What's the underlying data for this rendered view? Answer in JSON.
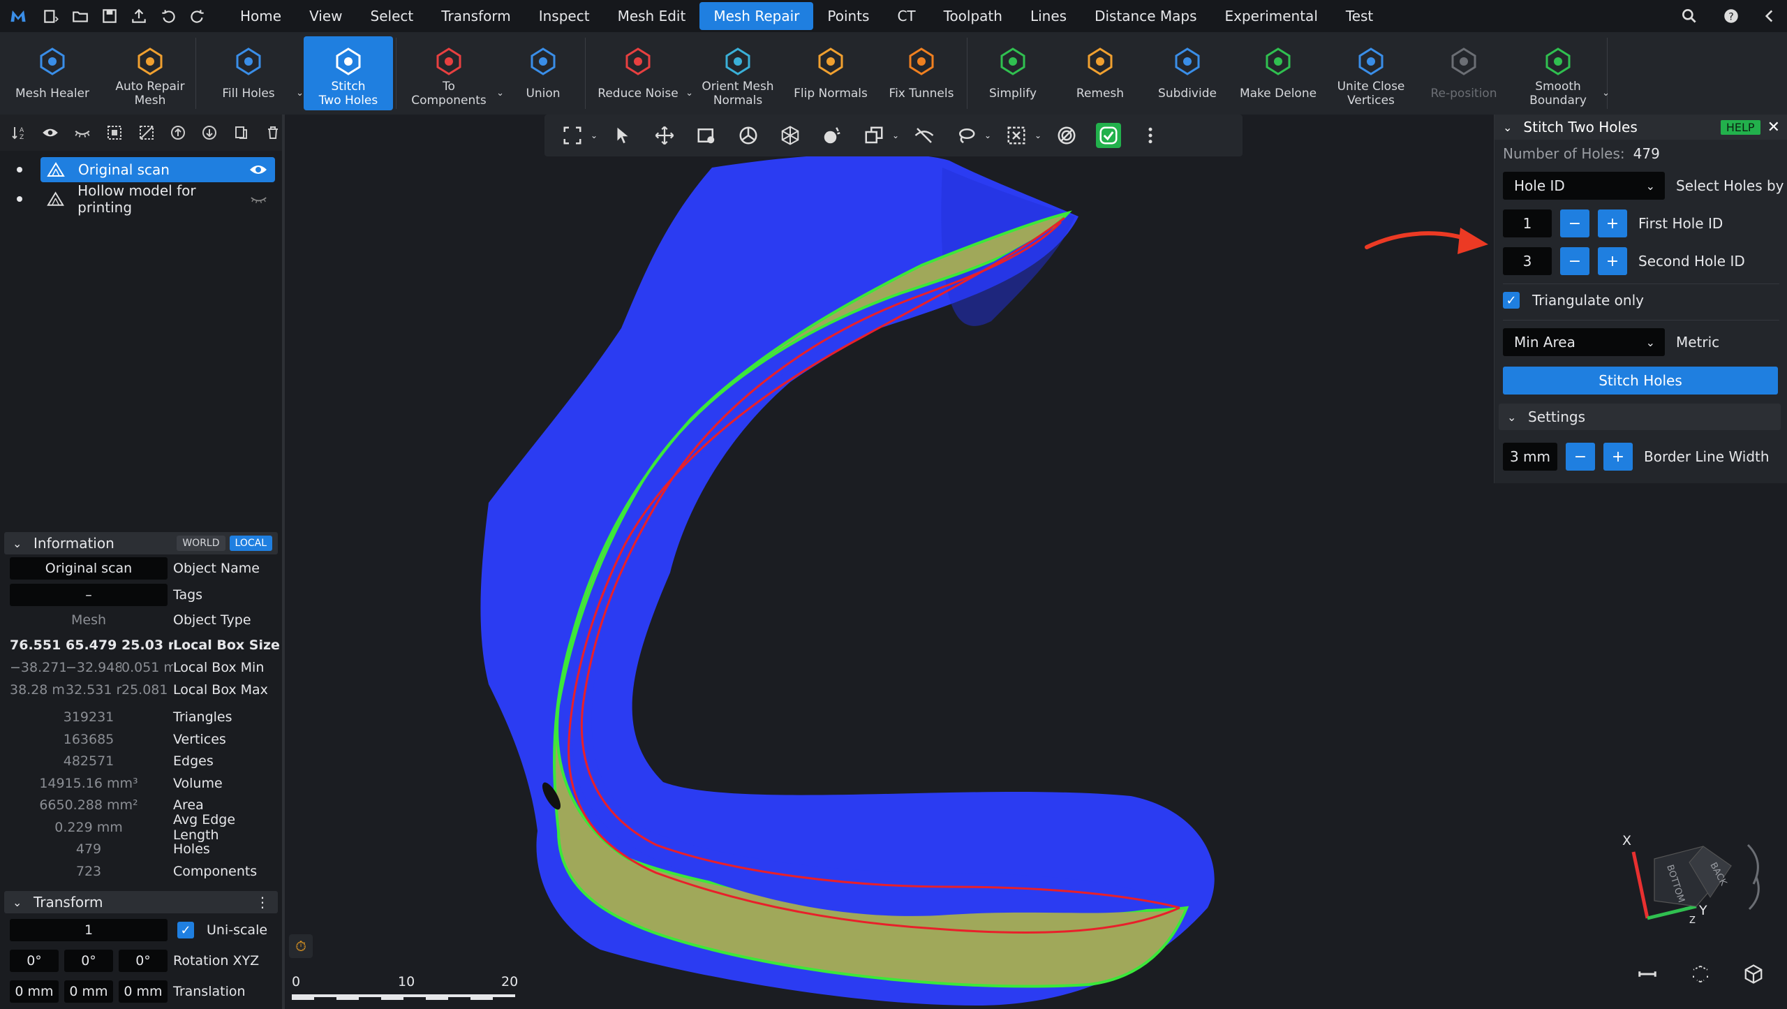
{
  "menubar": {
    "tabs": [
      "Home",
      "View",
      "Select",
      "Transform",
      "Inspect",
      "Mesh Edit",
      "Mesh Repair",
      "Points",
      "CT",
      "Toolpath",
      "Lines",
      "Distance Maps",
      "Experimental",
      "Test"
    ],
    "active": "Mesh Repair"
  },
  "ribbon": {
    "tools": [
      {
        "label": "Mesh Healer",
        "icon": "mesh-healer-icon",
        "color": "#3a8ee8"
      },
      {
        "label": "Auto Repair\nMesh",
        "icon": "auto-repair-icon",
        "color": "#f0a030"
      },
      {
        "label": "Fill Holes",
        "icon": "fill-holes-icon",
        "color": "#3a8ee8",
        "dropdown": true
      },
      {
        "label": "Stitch\nTwo Holes",
        "icon": "stitch-holes-icon",
        "color": "#ffffff",
        "active": true
      },
      {
        "label": "To\nComponents",
        "icon": "to-components-icon",
        "color": "#e84040",
        "dropdown": true
      },
      {
        "label": "Union",
        "icon": "union-icon",
        "color": "#3a8ee8"
      },
      {
        "label": "Reduce Noise",
        "icon": "reduce-noise-icon",
        "color": "#e84040",
        "dropdown": true
      },
      {
        "label": "Orient Mesh\nNormals",
        "icon": "orient-normals-icon",
        "color": "#3ab0d8"
      },
      {
        "label": "Flip Normals",
        "icon": "flip-normals-icon",
        "color": "#f0a030"
      },
      {
        "label": "Fix Tunnels",
        "icon": "fix-tunnels-icon",
        "color": "#f08020"
      },
      {
        "label": "Simplify",
        "icon": "simplify-icon",
        "color": "#30c050"
      },
      {
        "label": "Remesh",
        "icon": "remesh-icon",
        "color": "#f0a030"
      },
      {
        "label": "Subdivide",
        "icon": "subdivide-icon",
        "color": "#3a8ee8"
      },
      {
        "label": "Make Delone",
        "icon": "make-delone-icon",
        "color": "#30c050"
      },
      {
        "label": "Unite Close\nVertices",
        "icon": "unite-vertices-icon",
        "color": "#3a8ee8"
      },
      {
        "label": "Re-position",
        "icon": "reposition-icon",
        "color": "#6b6e74",
        "disabled": true
      },
      {
        "label": "Smooth\nBoundary",
        "icon": "smooth-boundary-icon",
        "color": "#30c050",
        "dropdown": true
      }
    ]
  },
  "scene": {
    "objects": [
      {
        "name": "Original scan",
        "selected": true
      },
      {
        "name": "Hollow model for printing",
        "selected": false
      }
    ]
  },
  "info": {
    "title": "Information",
    "world": "WORLD",
    "local": "LOCAL",
    "object_name": "Original scan",
    "object_name_label": "Object Name",
    "tags": "–",
    "tags_label": "Tags",
    "type": "Mesh",
    "type_label": "Object Type",
    "box_size": [
      "76.551",
      "65.479 r",
      "25.03 r"
    ],
    "box_size_label": "Local Box Size",
    "box_min": [
      "−38.271",
      "−32.948",
      "0.051 m"
    ],
    "box_min_label": "Local Box Min",
    "box_max": [
      "38.28 m",
      "32.531 r",
      "25.081 r"
    ],
    "box_max_label": "Local Box Max",
    "stats": [
      {
        "v": "319231",
        "l": "Triangles"
      },
      {
        "v": "163685",
        "l": "Vertices"
      },
      {
        "v": "482571",
        "l": "Edges"
      },
      {
        "v": "14915.16 mm³",
        "l": "Volume"
      },
      {
        "v": "6650.288 mm²",
        "l": "Area"
      },
      {
        "v": "0.229 mm",
        "l": "Avg Edge Length"
      },
      {
        "v": "479",
        "l": "Holes"
      },
      {
        "v": "723",
        "l": "Components"
      }
    ]
  },
  "transform": {
    "title": "Transform",
    "scale": "1",
    "uniscale": "Uni-scale",
    "rot": [
      "0°",
      "0°",
      "0°"
    ],
    "rot_label": "Rotation XYZ",
    "trans": [
      "0 mm",
      "0 mm",
      "0 mm"
    ],
    "trans_label": "Translation"
  },
  "panel": {
    "title": "Stitch Two Holes",
    "help": "HELP",
    "holes_label": "Number of Holes:",
    "holes": "479",
    "select_by": "Hole ID",
    "select_by_label": "Select Holes by",
    "first_id": "1",
    "first_label": "First Hole ID",
    "second_id": "3",
    "second_label": "Second Hole ID",
    "triangulate": "Triangulate only",
    "metric": "Min Area",
    "metric_label": "Metric",
    "stitch_btn": "Stitch Holes",
    "settings": "Settings",
    "border_width": "3 mm",
    "border_label": "Border Line Width"
  },
  "scale": {
    "ticks": [
      "0",
      "10",
      "20"
    ]
  },
  "triad": {
    "x": "X",
    "y": "Y",
    "z": "Z",
    "bottom": "BOTTOM",
    "back": "BACK"
  },
  "colors": {
    "accent": "#1f7fe0",
    "mesh": "#2b3cf2",
    "inner": "#a0a85a",
    "edge_green": "#3ce83a",
    "edge_red": "#e8202a",
    "help": "#22b14c"
  }
}
